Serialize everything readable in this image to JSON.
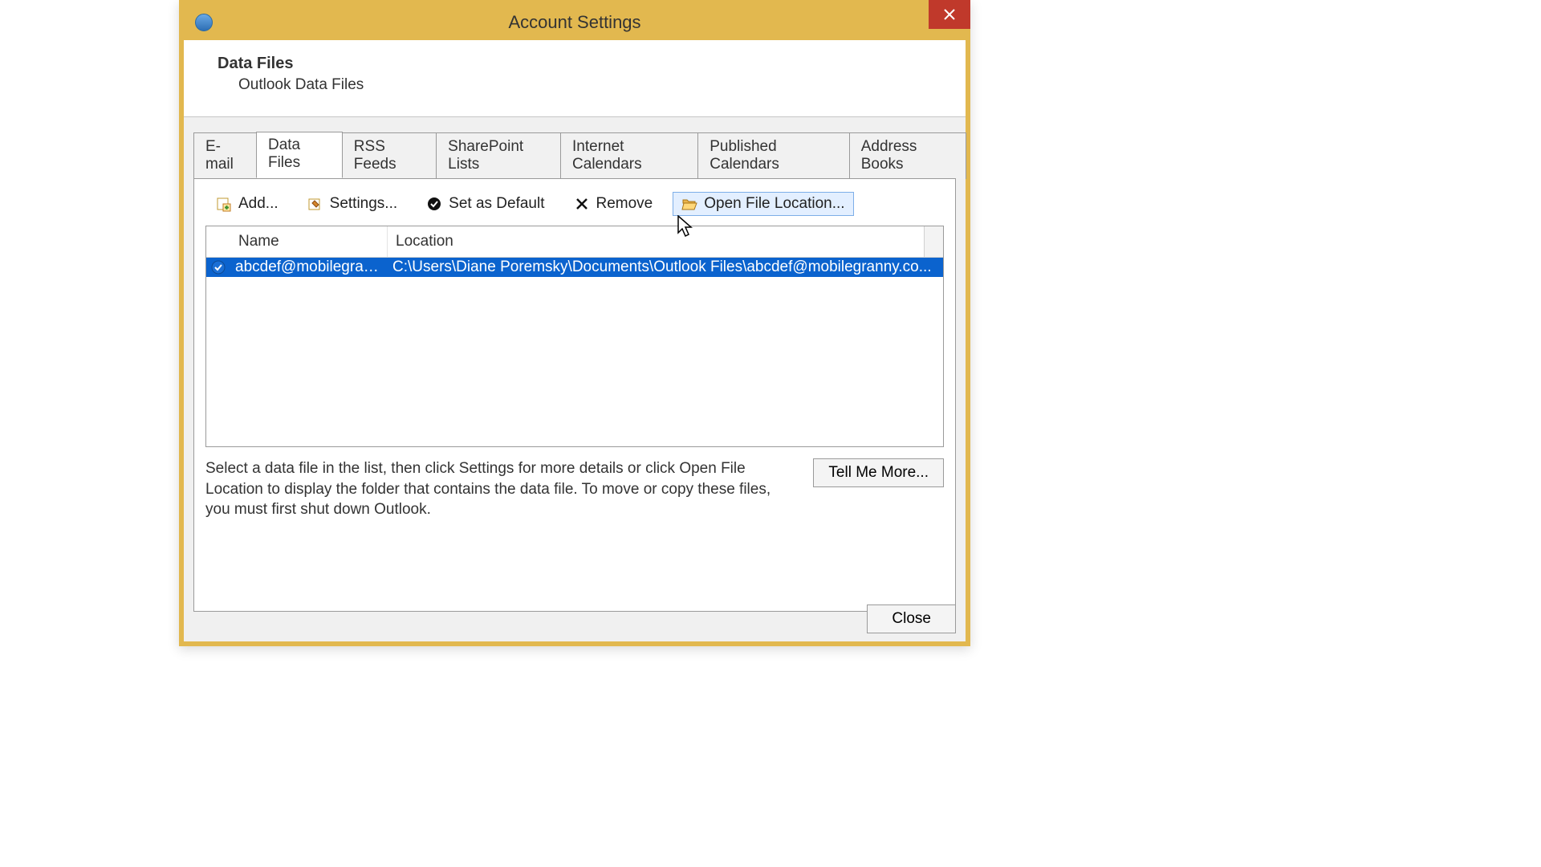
{
  "window": {
    "title": "Account Settings",
    "close_tooltip": "Close"
  },
  "header": {
    "title": "Data Files",
    "subtitle": "Outlook Data Files"
  },
  "tabs": [
    {
      "label": "E-mail",
      "active": false
    },
    {
      "label": "Data Files",
      "active": true
    },
    {
      "label": "RSS Feeds",
      "active": false
    },
    {
      "label": "SharePoint Lists",
      "active": false
    },
    {
      "label": "Internet Calendars",
      "active": false
    },
    {
      "label": "Published Calendars",
      "active": false
    },
    {
      "label": "Address Books",
      "active": false
    }
  ],
  "toolbar": {
    "add": "Add...",
    "settings": "Settings...",
    "set_default": "Set as Default",
    "remove": "Remove",
    "open_location": "Open File Location..."
  },
  "columns": {
    "name": "Name",
    "location": "Location"
  },
  "rows": [
    {
      "name": "abcdef@mobilegran...",
      "location": "C:\\Users\\Diane Poremsky\\Documents\\Outlook Files\\abcdef@mobilegranny.co...",
      "default": true,
      "selected": true
    }
  ],
  "info_text": "Select a data file in the list, then click Settings for more details or click Open File Location to display the folder that contains the data file. To move or copy these files, you must first shut down Outlook.",
  "buttons": {
    "tell_me_more": "Tell Me More...",
    "close": "Close"
  }
}
